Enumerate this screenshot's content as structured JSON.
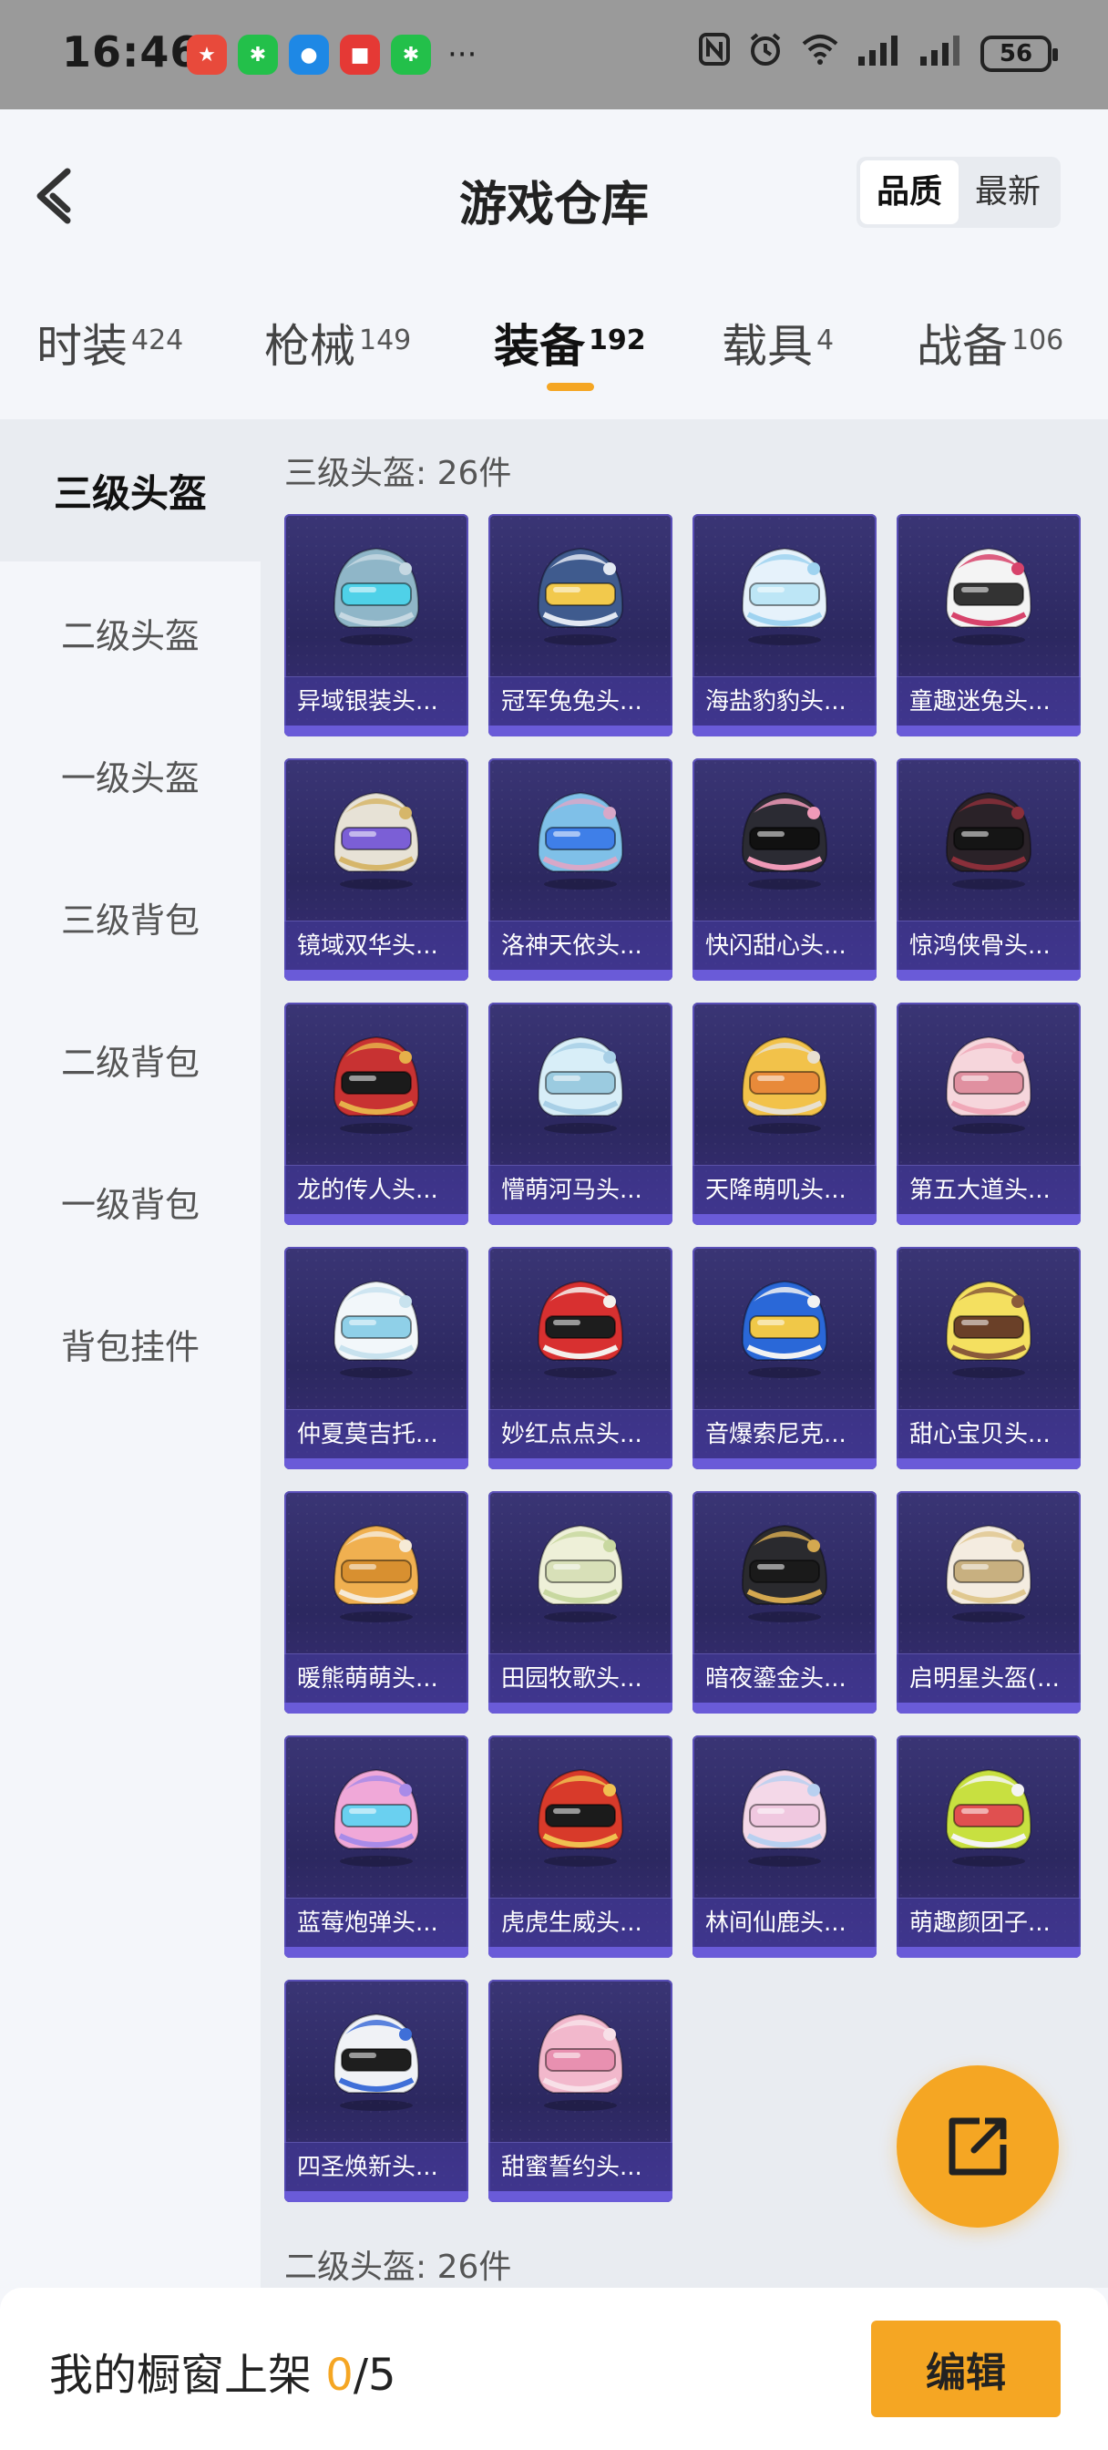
{
  "status_bar": {
    "time": "16:46",
    "battery": "56",
    "apps": [
      {
        "icon": "app-badge-icon",
        "color": "#e84a3b",
        "glyph": "★"
      },
      {
        "icon": "wechat-icon",
        "color": "#23c04a",
        "glyph": "✱"
      },
      {
        "icon": "message-icon",
        "color": "#1e88e5",
        "glyph": "●"
      },
      {
        "icon": "red-app-icon",
        "color": "#e53935",
        "glyph": "■"
      },
      {
        "icon": "wechat-icon",
        "color": "#23c04a",
        "glyph": "✱"
      }
    ],
    "more": "···"
  },
  "header": {
    "title": "游戏仓库",
    "sort_quality": "品质",
    "sort_latest": "最新"
  },
  "tabs": [
    {
      "label": "时装",
      "count": "424"
    },
    {
      "label": "枪械",
      "count": "149"
    },
    {
      "label": "装备",
      "count": "192"
    },
    {
      "label": "载具",
      "count": "4"
    },
    {
      "label": "战备",
      "count": "106"
    }
  ],
  "sidebar": {
    "items": [
      "三级头盔",
      "二级头盔",
      "一级头盔",
      "三级背包",
      "二级背包",
      "一级背包",
      "背包挂件"
    ]
  },
  "sections": [
    {
      "title": "三级头盔: 26件",
      "items": [
        {
          "name": "异域银装头...",
          "c1": "#8fb6c8",
          "c2": "#c6d8e2",
          "visor": "#4fd1e8"
        },
        {
          "name": "冠军兔兔头...",
          "c1": "#3f5b8e",
          "c2": "#e2e8f2",
          "visor": "#f2c94c"
        },
        {
          "name": "海盐豹豹头...",
          "c1": "#e6f2fb",
          "c2": "#9fd3f0",
          "visor": "#bde6f6"
        },
        {
          "name": "童趣迷兔头...",
          "c1": "#f4f4f4",
          "c2": "#d7436b",
          "visor": "#333333"
        },
        {
          "name": "镜域双华头...",
          "c1": "#e7e2d6",
          "c2": "#d6b66a",
          "visor": "#7b5fd6"
        },
        {
          "name": "洛神天依头...",
          "c1": "#7fc0e8",
          "c2": "#d8a8c8",
          "visor": "#3f7fe8"
        },
        {
          "name": "快闪甜心头...",
          "c1": "#2b2b33",
          "c2": "#f09ab8",
          "visor": "#111111"
        },
        {
          "name": "惊鸿侠骨头...",
          "c1": "#2a2228",
          "c2": "#8a2f3a",
          "visor": "#151515"
        },
        {
          "name": "龙的传人头...",
          "c1": "#c83232",
          "c2": "#e6b04a",
          "visor": "#1b1b1b"
        },
        {
          "name": "懵萌河马头...",
          "c1": "#d8eef8",
          "c2": "#a8cfe6",
          "visor": "#9bcbe0"
        },
        {
          "name": "天降萌叽头...",
          "c1": "#f2c24a",
          "c2": "#e8e0d0",
          "visor": "#e88a3a"
        },
        {
          "name": "第五大道头...",
          "c1": "#f6d6dc",
          "c2": "#f0a8b8",
          "visor": "#e090a0"
        },
        {
          "name": "仲夏莫吉托...",
          "c1": "#f2f7fa",
          "c2": "#c8e2ee",
          "visor": "#8fd0e8"
        },
        {
          "name": "妙红点点头...",
          "c1": "#d83030",
          "c2": "#f4f0ec",
          "visor": "#1d1d1d"
        },
        {
          "name": "音爆索尼克...",
          "c1": "#2a68d8",
          "c2": "#f2f2f2",
          "visor": "#f0c848"
        },
        {
          "name": "甜心宝贝头...",
          "c1": "#f4e060",
          "c2": "#8a5a3a",
          "visor": "#6a4028"
        },
        {
          "name": "暖熊萌萌头...",
          "c1": "#f0b050",
          "c2": "#f6ead6",
          "visor": "#d89030"
        },
        {
          "name": "田园牧歌头...",
          "c1": "#eef0d8",
          "c2": "#c8d8a0",
          "visor": "#d8e0b8"
        },
        {
          "name": "暗夜鎏金头...",
          "c1": "#2a2a2e",
          "c2": "#d4a850",
          "visor": "#1a1a1a"
        },
        {
          "name": "启明星头盔(...",
          "c1": "#f4ece0",
          "c2": "#e0c890",
          "visor": "#c8b080"
        },
        {
          "name": "蓝莓炮弹头...",
          "c1": "#f0a8d8",
          "c2": "#a88be8",
          "visor": "#6ad0f0"
        },
        {
          "name": "虎虎生威头...",
          "c1": "#d83a2a",
          "c2": "#f0c050",
          "visor": "#1b1b1b"
        },
        {
          "name": "林间仙鹿头...",
          "c1": "#f4d8e8",
          "c2": "#b8d0f0",
          "visor": "#f0c8e0"
        },
        {
          "name": "萌趣颜团子...",
          "c1": "#c8e040",
          "c2": "#f4f4f4",
          "visor": "#e05050"
        },
        {
          "name": "四圣焕新头...",
          "c1": "#f0f2f6",
          "c2": "#3f6fd8",
          "visor": "#1e1e1e"
        },
        {
          "name": "甜蜜誓约头...",
          "c1": "#f2b8cc",
          "c2": "#f8e0e8",
          "visor": "#e890b0"
        }
      ]
    },
    {
      "title": "二级头盔: 26件",
      "items": []
    }
  ],
  "bottom": {
    "showcase_label": "我的橱窗上架",
    "showcase_count": "0",
    "showcase_total": "/5",
    "edit_label": "编辑"
  }
}
